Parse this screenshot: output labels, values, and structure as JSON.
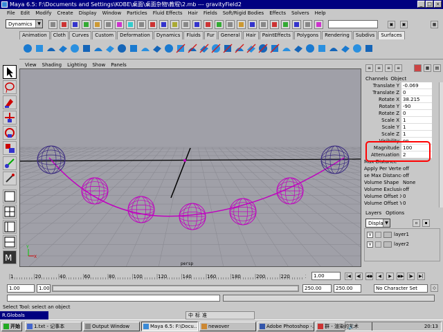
{
  "window": {
    "title": "Maya 6.5: F:\\Documents and Settings\\KOBE\\桌面\\桌面杂物\\教程\\2.mb   ---   gravityField2"
  },
  "menubar": [
    "File",
    "Edit",
    "Modify",
    "Create",
    "Display",
    "Window",
    "Particles",
    "Fluid Effects",
    "Hair",
    "Fields",
    "Soft/Rigid Bodies",
    "Effects",
    "Solvers",
    "Help"
  ],
  "menu_set": "Dynamics",
  "shelf_tabs": [
    "Animation",
    "Cloth",
    "Curves",
    "Custom",
    "Deformation",
    "Dynamics",
    "Fluids",
    "Fur",
    "General",
    "Hair",
    "PaintEffects",
    "Polygons",
    "Rendering",
    "Subdivs",
    "Surfaces"
  ],
  "shelf_active": "Surfaces",
  "viewport": {
    "menus": [
      "View",
      "Shading",
      "Lighting",
      "Show",
      "Panels"
    ],
    "camera_label": "persp"
  },
  "channel_box": {
    "tabs": [
      "Channels",
      "Object"
    ],
    "rows": [
      {
        "label": "Translate Y",
        "value": "-0.069"
      },
      {
        "label": "Translate Z",
        "value": "0"
      },
      {
        "label": "Rotate X",
        "value": "38.215"
      },
      {
        "label": "Rotate Y",
        "value": "-90"
      },
      {
        "label": "Rotate Z",
        "value": "0"
      },
      {
        "label": "Scale X",
        "value": "1"
      },
      {
        "label": "Scale Y",
        "value": "1"
      },
      {
        "label": "Scale Z",
        "value": "1"
      },
      {
        "label": "Visibility",
        "value": "on"
      },
      {
        "label": "Magnitude",
        "value": "100"
      },
      {
        "label": "Attenuation",
        "value": "2"
      },
      {
        "label": "Max Distance",
        "value": ""
      },
      {
        "label": "Apply Per Vertex",
        "value": "off"
      },
      {
        "label": "se Max Distance",
        "value": "off"
      },
      {
        "label": "Volume Shape",
        "value": "None"
      },
      {
        "label": "Volume Exclusion",
        "value": "off"
      },
      {
        "label": "Volume Offset X",
        "value": "0"
      },
      {
        "label": "Volume Offset Y",
        "value": "0"
      }
    ]
  },
  "layers": {
    "tabs": [
      "Layers",
      "Options"
    ],
    "display_mode": "Display",
    "items": [
      {
        "visible": "V",
        "name": "layer1"
      },
      {
        "visible": "V",
        "name": "layer2"
      }
    ]
  },
  "timeline": {
    "ticks": [
      "1",
      "20",
      "40",
      "60",
      "80",
      "100",
      "120",
      "140",
      "160",
      "180",
      "200",
      "220",
      "240"
    ],
    "current_frame": "1.00"
  },
  "range": {
    "start": "1.00",
    "playback_start": "1.00",
    "playback_end": "250.00",
    "end": "250.00",
    "character_set": "No Character Set"
  },
  "help_line": "Select Tool: select an object",
  "render_globals": "R.Globals",
  "ime": {
    "items": [
      "中",
      "标",
      "准"
    ]
  },
  "taskbar": {
    "start": "开始",
    "tasks": [
      {
        "label": "1.txt - 记事本",
        "active": false
      },
      {
        "label": "Output Window",
        "active": false
      },
      {
        "label": "Maya 6.5: F:\\Docu...",
        "active": true
      },
      {
        "label": "newover",
        "active": false
      },
      {
        "label": "Adobe Photoshop -...",
        "active": false
      },
      {
        "label": "群 - 渲染的艺术",
        "active": false
      }
    ],
    "clock": "20:13"
  },
  "colors": {
    "title_bar": "#000080",
    "sphere": "#c000c0",
    "highlight_box": "#ff0000",
    "viewport_bg": "#a0a0a8"
  }
}
